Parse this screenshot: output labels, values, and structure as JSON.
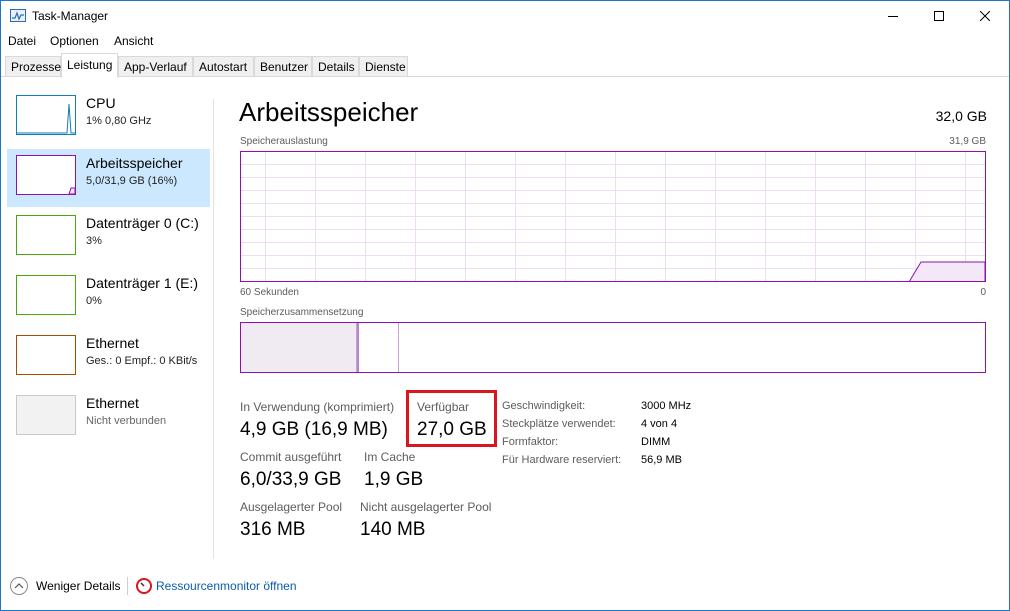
{
  "window": {
    "title": "Task-Manager"
  },
  "menu": [
    "Datei",
    "Optionen",
    "Ansicht"
  ],
  "tabs": [
    "Prozesse",
    "Leistung",
    "App-Verlauf",
    "Autostart",
    "Benutzer",
    "Details",
    "Dienste"
  ],
  "sidebar": {
    "items": [
      {
        "title": "CPU",
        "sub": "1% 0,80 GHz"
      },
      {
        "title": "Arbeitsspeicher",
        "sub": "5,0/31,9 GB (16%)"
      },
      {
        "title": "Datenträger 0 (C:)",
        "sub": "3%"
      },
      {
        "title": "Datenträger 1 (E:)",
        "sub": "0%"
      },
      {
        "title": "Ethernet",
        "sub": "Ges.: 0 Empf.: 0 KBit/s"
      },
      {
        "title": "Ethernet",
        "sub": "Nicht verbunden"
      }
    ]
  },
  "main": {
    "title": "Arbeitsspeicher",
    "capacity": "32,0 GB",
    "usage_label": "Speicherauslastung",
    "usage_max": "31,9 GB",
    "time_left": "60 Sekunden",
    "time_right": "0",
    "composition_label": "Speicherzusammensetzung",
    "stats": {
      "in_use_label": "In Verwendung (komprimiert)",
      "in_use_value": "4,9 GB (16,9 MB)",
      "available_label": "Verfügbar",
      "available_value": "27,0 GB",
      "committed_label": "Commit ausgeführt",
      "committed_value": "6,0/33,9 GB",
      "cached_label": "Im Cache",
      "cached_value": "1,9 GB",
      "paged_label": "Ausgelagerter Pool",
      "paged_value": "316 MB",
      "nonpaged_label": "Nicht ausgelagerter Pool",
      "nonpaged_value": "140 MB"
    },
    "props": [
      {
        "label": "Geschwindigkeit:",
        "value": "3000 MHz"
      },
      {
        "label": "Steckplätze verwendet:",
        "value": "4 von 4"
      },
      {
        "label": "Formfaktor:",
        "value": "DIMM"
      },
      {
        "label": "Für Hardware reserviert:",
        "value": "56,9 MB"
      }
    ]
  },
  "footer": {
    "less_details": "Weniger Details",
    "resource_monitor": "Ressourcenmonitor öffnen"
  },
  "colors": {
    "memory_accent": "#8b12ae",
    "cpu_accent": "#117dbb",
    "disk_accent": "#4da60c",
    "ethernet_accent": "#a74f01",
    "highlight": "#d9161d",
    "selected_bg": "#cce8ff"
  }
}
